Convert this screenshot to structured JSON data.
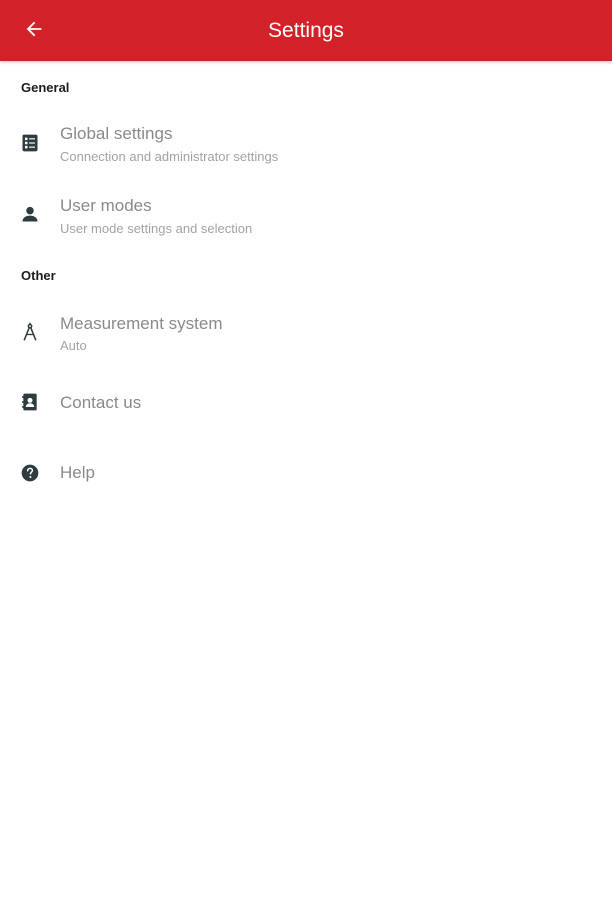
{
  "app_bar": {
    "title": "Settings",
    "back_icon": "arrow-left-icon",
    "background_color": "#d32129"
  },
  "sections": [
    {
      "header": "General",
      "items": [
        {
          "title": "Global settings",
          "subtitle": "Connection and administrator settings",
          "icon": "settings-list-icon"
        },
        {
          "title": "User modes",
          "subtitle": "User mode settings and selection",
          "icon": "person-icon"
        }
      ]
    },
    {
      "header": "Other",
      "items": [
        {
          "title": "Measurement system",
          "subtitle": "Auto",
          "icon": "compass-icon"
        },
        {
          "title": "Contact us",
          "icon": "contact-card-icon"
        },
        {
          "title": "Help",
          "icon": "help-circle-icon"
        }
      ]
    }
  ]
}
